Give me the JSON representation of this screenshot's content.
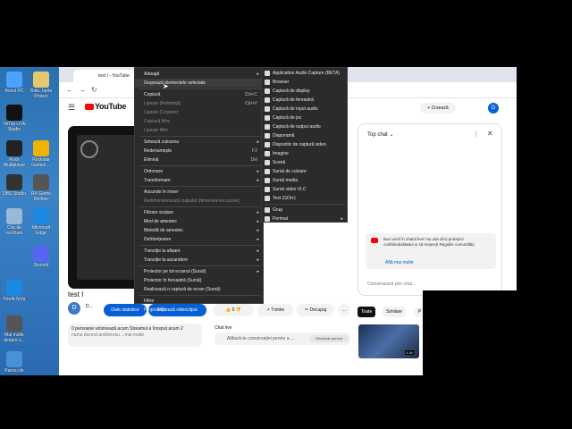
{
  "desktop": {
    "icons": [
      {
        "label": "Acest PC",
        "color": "#4aa3ff"
      },
      {
        "label": "Date, tepte Proiect",
        "color": "#e8c96a"
      },
      {
        "label": "TikTok LIVE Studio",
        "color": "#111111"
      },
      {
        "label": "Rockstar Games ...",
        "color": "#f0b400"
      },
      {
        "label": "Rock Multiplayer",
        "color": "#222222"
      },
      {
        "label": "OBS Studio",
        "color": "#333333"
      },
      {
        "label": "RX Game Refiner",
        "color": "#555555"
      },
      {
        "label": "Coș de reciclare",
        "color": "#9ab8d8"
      },
      {
        "label": "Microsoft Edge",
        "color": "#1e88e5"
      },
      {
        "label": "Discord",
        "color": "#5865f2"
      },
      {
        "label": "Fire4LTeVa",
        "color": "#1e88e5"
      },
      {
        "label": "Mai multe despre s...",
        "color": "#555555"
      },
      {
        "label": "Panou de",
        "color": "#4a90d9"
      }
    ]
  },
  "browser": {
    "tab_title": "test I - YouTube",
    "youtube_logo": "YouTube",
    "youtube_region": "RO",
    "create_label": "+ Creează",
    "avatar_letter": "D"
  },
  "video": {
    "title": "test I",
    "channel_initial": "D",
    "channel_name": "D...",
    "stats_button": "Date statistice",
    "edit_button": "Editează videoclipul",
    "like_count": "0",
    "share_label": "Trimite",
    "cut_label": "Decupaj",
    "more_label": "...",
    "description_line1": "0 persoane vizionează acum  Streamul a început acum 2",
    "description_line2": "nume dscord andreiroxu ...mai multe"
  },
  "chat_live": {
    "title": "Chat live",
    "prompt": "Alătură-te conversației pentru a ...",
    "button": "Deschide panoul"
  },
  "chat_panel": {
    "title": "Top chat",
    "notice": "Bun venit în chatul live! Nu uita să-ți protejezi confidențialitatea și să respecți Regulile comunității.",
    "learn_more": "Află mai multe",
    "input_placeholder": "Conversează prin chat..."
  },
  "related": {
    "tab_all": "Toate",
    "tab_similar": "Similare",
    "tab_p": "P",
    "thumb_duration": "2:34"
  },
  "menu_main": {
    "items": [
      {
        "label": "Adaugă",
        "shortcut": "",
        "arrow": true,
        "disabled": false,
        "highlight": false
      },
      {
        "label": "Grupează elementele selectate",
        "shortcut": "",
        "arrow": false,
        "disabled": false,
        "highlight": true
      },
      {
        "label": "Copiază",
        "shortcut": "Ctrl+C",
        "arrow": false,
        "disabled": false,
        "highlight": false
      },
      {
        "label": "Lipește (Referință)",
        "shortcut": "Ctrl+V",
        "arrow": false,
        "disabled": true,
        "highlight": false
      },
      {
        "label": "Lipește (Copiere)",
        "shortcut": "",
        "arrow": false,
        "disabled": true,
        "highlight": false
      },
      {
        "label": "Copiază filtre",
        "shortcut": "",
        "arrow": false,
        "disabled": true,
        "highlight": false
      },
      {
        "label": "Lipește filtre",
        "shortcut": "",
        "arrow": false,
        "disabled": true,
        "highlight": false
      },
      {
        "label": "Setează culoarea",
        "shortcut": "",
        "arrow": true,
        "disabled": false,
        "highlight": false
      },
      {
        "label": "Redenumește",
        "shortcut": "F2",
        "arrow": false,
        "disabled": false,
        "highlight": false
      },
      {
        "label": "Elimină",
        "shortcut": "Del",
        "arrow": false,
        "disabled": false,
        "highlight": false
      },
      {
        "label": "Ordonare",
        "shortcut": "",
        "arrow": true,
        "disabled": false,
        "highlight": false
      },
      {
        "label": "Transformare",
        "shortcut": "",
        "arrow": true,
        "disabled": false,
        "highlight": false
      },
      {
        "label": "Ascunde în mixer",
        "shortcut": "",
        "arrow": false,
        "disabled": false,
        "highlight": false
      },
      {
        "label": "Redimensionează outputul (dimensiunea sursei)",
        "shortcut": "",
        "arrow": false,
        "disabled": true,
        "highlight": false
      },
      {
        "label": "Filtrare scalare",
        "shortcut": "",
        "arrow": true,
        "disabled": false,
        "highlight": false
      },
      {
        "label": "Mod de amestec",
        "shortcut": "",
        "arrow": true,
        "disabled": false,
        "highlight": false
      },
      {
        "label": "Metodă de amestec",
        "shortcut": "",
        "arrow": true,
        "disabled": false,
        "highlight": false
      },
      {
        "label": "Deîntrețesere",
        "shortcut": "",
        "arrow": true,
        "disabled": false,
        "highlight": false
      },
      {
        "label": "Tranziție la afișare",
        "shortcut": "",
        "arrow": true,
        "disabled": false,
        "highlight": false
      },
      {
        "label": "Tranziție la ascundere",
        "shortcut": "",
        "arrow": true,
        "disabled": false,
        "highlight": false
      },
      {
        "label": "Proiector pe tot ecranul (Sursă)",
        "shortcut": "",
        "arrow": true,
        "disabled": false,
        "highlight": false
      },
      {
        "label": "Proiector în fereastră (Sursă)",
        "shortcut": "",
        "arrow": false,
        "disabled": false,
        "highlight": false
      },
      {
        "label": "Realizează o captură de ecran (Sursă)",
        "shortcut": "",
        "arrow": false,
        "disabled": false,
        "highlight": false
      },
      {
        "label": "Filtre",
        "shortcut": "",
        "arrow": false,
        "disabled": false,
        "highlight": false
      },
      {
        "label": "Proprietăți",
        "shortcut": "",
        "arrow": false,
        "disabled": false,
        "highlight": false
      }
    ]
  },
  "menu_sub": {
    "items": [
      {
        "label": "Application Audio Capture (BETA)",
        "arrow": false
      },
      {
        "label": "Browser",
        "arrow": false
      },
      {
        "label": "Captură de display",
        "arrow": false
      },
      {
        "label": "Captură de fereastră",
        "arrow": false
      },
      {
        "label": "Captură de input audio",
        "arrow": false
      },
      {
        "label": "Captură de joc",
        "arrow": false
      },
      {
        "label": "Captură de output audio",
        "arrow": false
      },
      {
        "label": "Diaporamă",
        "arrow": false
      },
      {
        "label": "Dispozitiv de captură video",
        "arrow": false
      },
      {
        "label": "Imagine",
        "arrow": false
      },
      {
        "label": "Scenă",
        "arrow": false
      },
      {
        "label": "Sursă de culoare",
        "arrow": false
      },
      {
        "label": "Sursă media",
        "arrow": false
      },
      {
        "label": "Sursă video VLC",
        "arrow": false
      },
      {
        "label": "Text (GDI+)",
        "arrow": false
      },
      {
        "label": "Grup",
        "arrow": false
      },
      {
        "label": "Perimat",
        "arrow": true
      }
    ]
  }
}
